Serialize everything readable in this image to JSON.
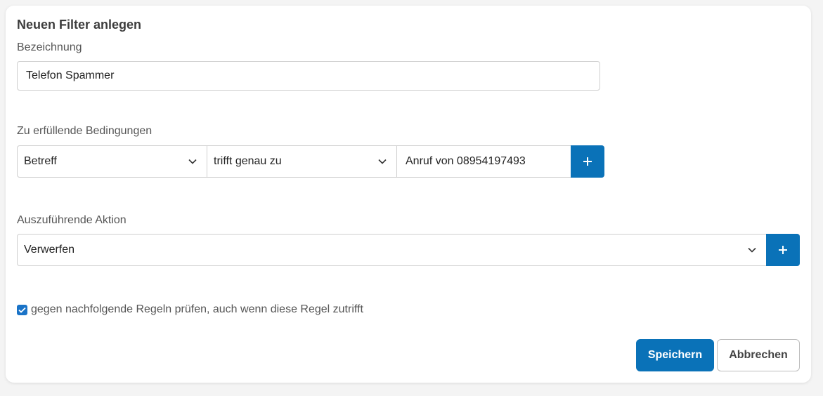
{
  "dialog": {
    "title": "Neuen Filter anlegen"
  },
  "name_field": {
    "label": "Bezeichnung",
    "value": "Telefon Spammer"
  },
  "conditions": {
    "label": "Zu erfüllende Bedingungen",
    "field_select": "Betreff",
    "operator_select": "trifft genau zu",
    "value": "Anruf von 08954197493",
    "add_icon": "plus-icon"
  },
  "actions": {
    "label": "Auszuführende Aktion",
    "action_select": "Verwerfen",
    "add_icon": "plus-icon"
  },
  "continue_check": {
    "checked": true,
    "label": "gegen nachfolgende Regeln prüfen, auch wenn diese Regel zutrifft"
  },
  "footer": {
    "save_label": "Speichern",
    "cancel_label": "Abbrechen"
  },
  "colors": {
    "accent": "#0a72b8",
    "background": "#f4f4f4",
    "card": "#ffffff",
    "border": "#cfcfcf"
  }
}
